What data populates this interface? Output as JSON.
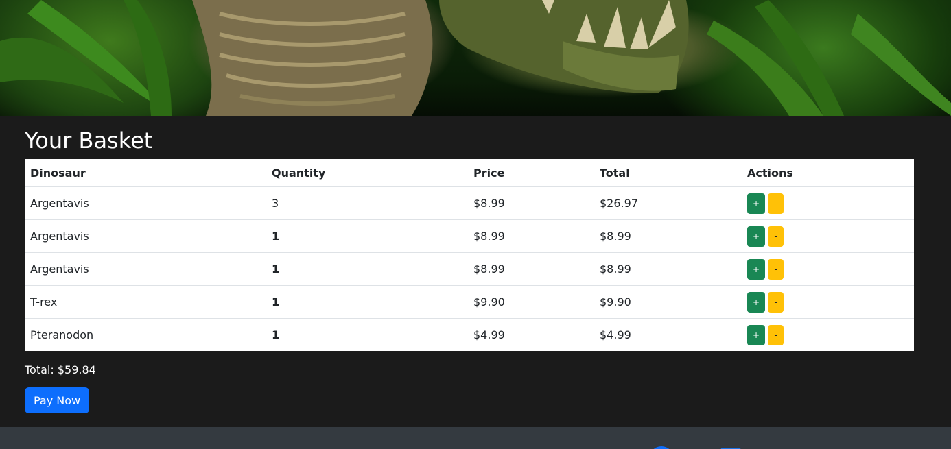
{
  "page": {
    "title": "Your Basket",
    "hero_image": "jungle-dinosaur-banner"
  },
  "basket": {
    "columns": [
      "Dinosaur",
      "Quantity",
      "Price",
      "Total",
      "Actions"
    ],
    "rows": [
      {
        "dinosaur": "Argentavis",
        "quantity": "3",
        "price": "$8.99",
        "total": "$26.97"
      },
      {
        "dinosaur": "Argentavis",
        "quantity": "1",
        "price": "$8.99",
        "total": "$8.99"
      },
      {
        "dinosaur": "Argentavis",
        "quantity": "1",
        "price": "$8.99",
        "total": "$8.99"
      },
      {
        "dinosaur": "T-rex",
        "quantity": "1",
        "price": "$9.90",
        "total": "$9.90"
      },
      {
        "dinosaur": "Pteranodon",
        "quantity": "1",
        "price": "$4.99",
        "total": "$4.99"
      }
    ],
    "plus_label": "+",
    "minus_label": "-"
  },
  "summary": {
    "total_text": "Total: $59.84",
    "pay_label": "Pay Now"
  },
  "footer": {
    "icons": [
      "social-circle-icon",
      "social-square-icon"
    ]
  },
  "colors": {
    "plus": "#198754",
    "minus": "#ffc107",
    "pay": "#0d6efd",
    "background": "#1b1b1b",
    "footer": "#343a40"
  }
}
